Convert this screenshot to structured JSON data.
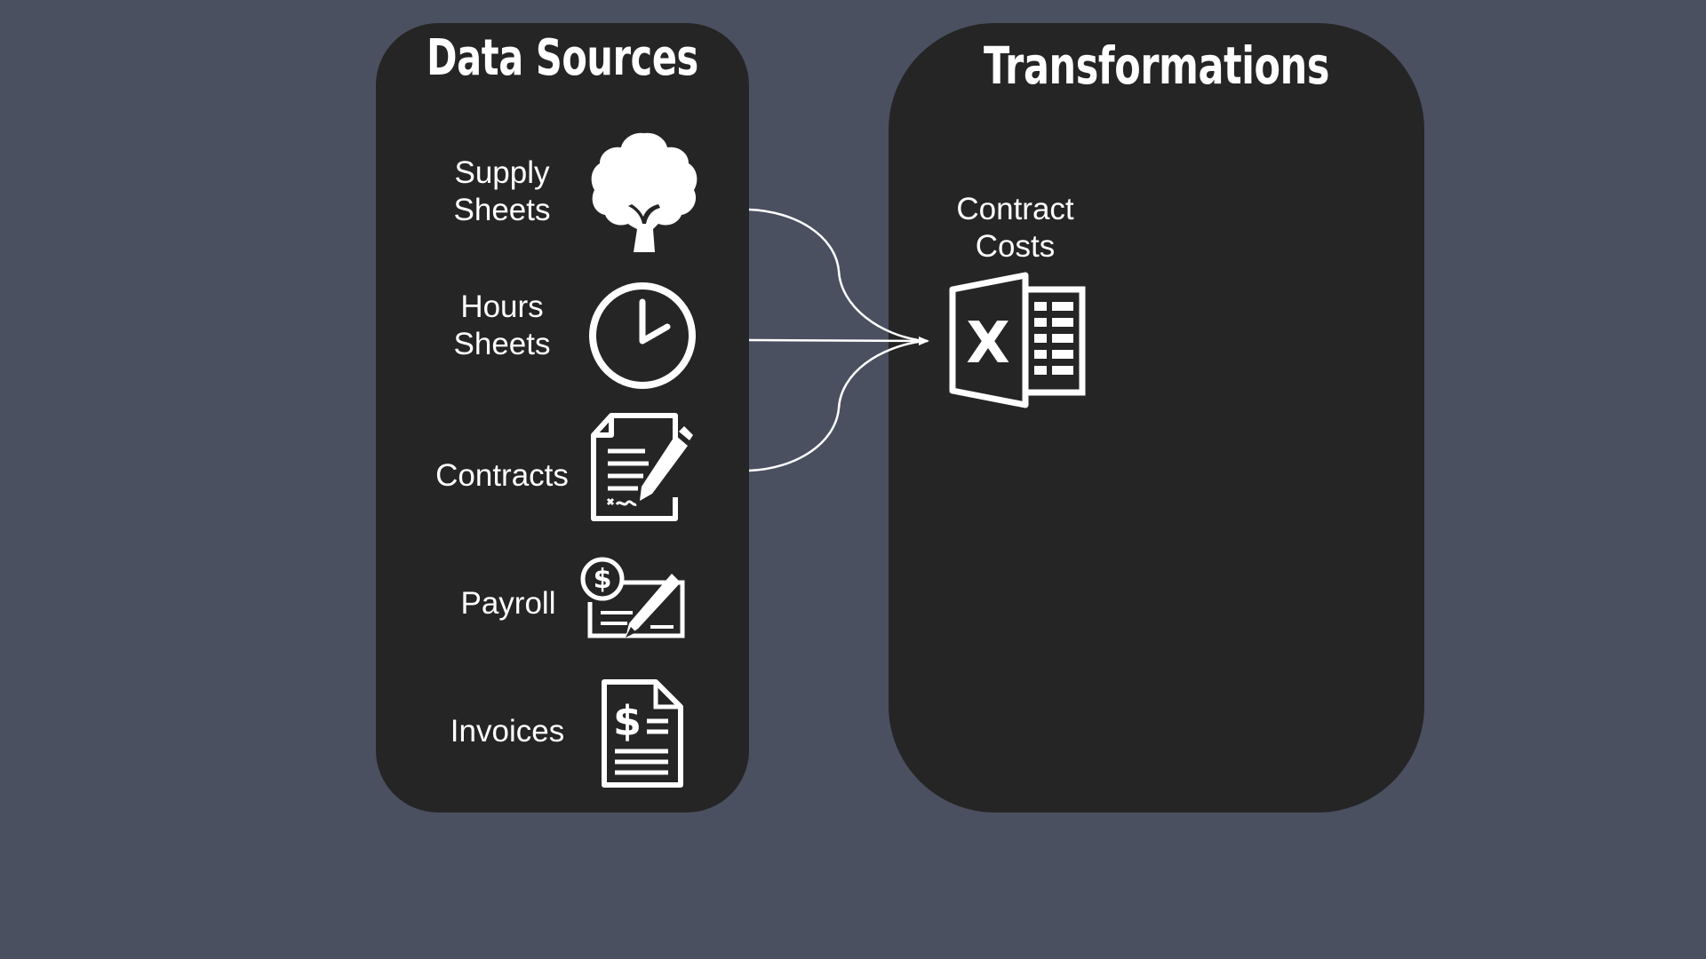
{
  "data_sources": {
    "title": "Data Sources",
    "items": [
      {
        "label": "Supply\nSheets",
        "icon": "tree-icon"
      },
      {
        "label": "Hours\nSheets",
        "icon": "clock-icon"
      },
      {
        "label": "Contracts",
        "icon": "signed-contract-icon"
      },
      {
        "label": "Payroll",
        "icon": "dollar-check-icon"
      },
      {
        "label": "Invoices",
        "icon": "invoice-dollar-icon"
      }
    ]
  },
  "transformations": {
    "title": "Transformations",
    "items": [
      {
        "label": "Contract\nCosts",
        "icon": "excel-spreadsheet-icon"
      }
    ]
  },
  "connections": [
    {
      "from": "Supply Sheets",
      "to": "Contract Costs"
    },
    {
      "from": "Hours Sheets",
      "to": "Contract Costs"
    },
    {
      "from": "Contracts",
      "to": "Contract Costs"
    }
  ],
  "colors": {
    "background": "#4a5060",
    "panel": "#252525",
    "foreground": "#ffffff"
  }
}
